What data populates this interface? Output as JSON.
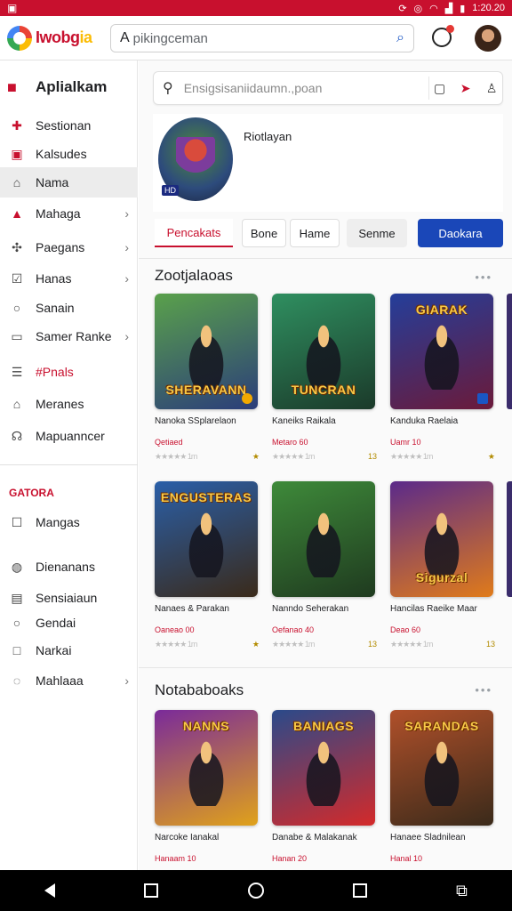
{
  "status": {
    "time": "1:20.20"
  },
  "header": {
    "logo_text_1": "Iwobg",
    "logo_text_2": "ia",
    "search_placeholder": "pikingceman"
  },
  "sidebar": {
    "title": "Aplialkam",
    "items": [
      {
        "label": "Sestionan",
        "icon": "gift-icon"
      },
      {
        "label": "Kalsudes",
        "icon": "calendar-icon"
      },
      {
        "label": "Nama",
        "icon": "home-icon"
      },
      {
        "label": "Mahaga",
        "icon": "bell-icon"
      },
      {
        "label": "Paegans",
        "icon": "controller-icon"
      },
      {
        "label": "Hanas",
        "icon": "checkbox-icon"
      },
      {
        "label": "Sanain",
        "icon": "search-icon"
      },
      {
        "label": "Samer Ranke",
        "icon": "card-icon"
      },
      {
        "label": "#Pnals",
        "icon": "list-icon"
      },
      {
        "label": "Meranes",
        "icon": "house-icon"
      },
      {
        "label": "Mapuanncer",
        "icon": "user-icon"
      }
    ],
    "section2_heading": "GATORA",
    "items2": [
      {
        "label": "Mangas",
        "icon": "box-icon"
      },
      {
        "label": "Dienanans",
        "icon": "shield-icon"
      },
      {
        "label": "Sensiaiaun",
        "icon": "building-icon"
      },
      {
        "label": "Gendai",
        "icon": "circle-icon"
      },
      {
        "label": "Narkai",
        "icon": "square-icon"
      },
      {
        "label": "Mahlaaa",
        "icon": "chat-icon"
      }
    ]
  },
  "main": {
    "search_placeholder": "Ensigsisaniidaumn.,poan",
    "hero_title": "Riotlayan",
    "hero_badge": "HD",
    "chips": [
      "Pencakats",
      "Bone",
      "Hame",
      "Senme",
      "Daokara"
    ],
    "section1": {
      "title": "Zootjalaoas",
      "more": "•••",
      "cards": [
        {
          "name": "Nanoka SSplarelaon",
          "sub": "Qetiaed",
          "rating": "1m",
          "meta_right": "★",
          "cap": "SHERAVANN",
          "colors": [
            "#5aa14b",
            "#2b3d7a"
          ]
        },
        {
          "name": "Kaneiks Raikala",
          "sub": "Metaro 60",
          "rating": "1m",
          "meta_right": "13",
          "cap": "TUNCRAN",
          "colors": [
            "#2f8f60",
            "#f1a100"
          ]
        },
        {
          "name": "Kanduka Raelaia",
          "sub": "Uamr 10",
          "rating": "1m",
          "meta_right": "★",
          "cap": "GIARAK",
          "colors": [
            "#243e9a",
            "#d8282c"
          ]
        }
      ]
    },
    "section2": {
      "cards": [
        {
          "name": "Nanaes & Parakan",
          "sub": "Oaneao 00",
          "rating": "1m",
          "meta_right": "★",
          "cap": "ENGUSTERAS",
          "colors": [
            "#2a5fa8",
            "#d46a1c"
          ]
        },
        {
          "name": "Nanndo Seherakan",
          "sub": "Oefanao 40",
          "rating": "1m",
          "meta_right": "13",
          "cap": "",
          "colors": [
            "#3e8a3a",
            "#2a5a2a"
          ]
        },
        {
          "name": "Hancilas Raeike Maar",
          "sub": "Deao 60",
          "rating": "1m",
          "meta_right": "13",
          "cap": "Sigurzal",
          "colors": [
            "#5b2a8a",
            "#e07b1a"
          ]
        }
      ]
    },
    "section3": {
      "title": "Notababoaks",
      "more": "•••",
      "cards": [
        {
          "name": "Narcoke Ianakal",
          "sub": "Hanaam 10",
          "cap": "NANNS",
          "colors": [
            "#7a2a9a",
            "#e0a21a"
          ]
        },
        {
          "name": "Danabe & Malakanak",
          "sub": "Hanan 20",
          "cap": "BANIAGS",
          "colors": [
            "#2a4a8a",
            "#d42a2a"
          ]
        },
        {
          "name": "Hanaee Sladnilean",
          "sub": "Hanal 10",
          "cap": "SARANDAS",
          "colors": [
            "#b0502a",
            "#3a2a1a"
          ]
        }
      ]
    }
  }
}
